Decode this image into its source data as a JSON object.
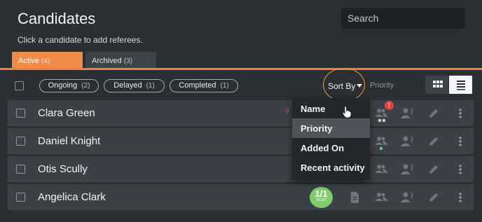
{
  "header": {
    "title": "Candidates",
    "subtitle": "Click a candidate to add referees.",
    "search_placeholder": "Search"
  },
  "tabs": [
    {
      "label": "Active",
      "count": "(4)",
      "active": true
    },
    {
      "label": "Archived",
      "count": "(3)",
      "active": false
    }
  ],
  "filters": [
    {
      "label": "Ongoing",
      "count": "(2)"
    },
    {
      "label": "Delayed",
      "count": "(1)"
    },
    {
      "label": "Completed",
      "count": "(1)"
    }
  ],
  "sort": {
    "label": "Sort By",
    "current": "Priority",
    "options": [
      "Name",
      "Priority",
      "Added On",
      "Recent activity"
    ],
    "highlighted": "Priority"
  },
  "candidates": [
    {
      "name": "Clara Green"
    },
    {
      "name": "Daniel Knight"
    },
    {
      "name": "Otis Scully"
    },
    {
      "name": "Angelica Clark"
    }
  ],
  "row_fragments": {
    "clara_partial_number": "9",
    "alert_badge": "!",
    "angelica_resp_value": "1/1",
    "angelica_resp_label": "RESP"
  },
  "colors": {
    "accent": "#f08a47",
    "ring": "#f0a02b",
    "alert": "#e0443b",
    "resp": "#7fce6a",
    "status_dot": "#5fd067"
  }
}
